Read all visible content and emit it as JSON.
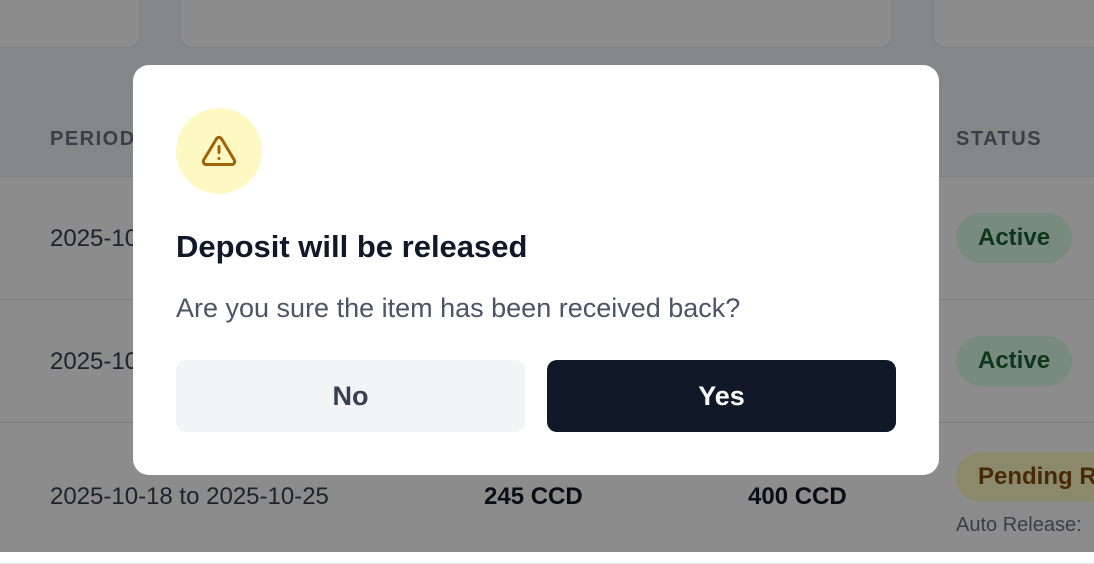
{
  "table": {
    "headers": {
      "period": "PERIOD",
      "status": "STATUS"
    },
    "rows": [
      {
        "period": "2025-10-",
        "status": "Active"
      },
      {
        "period": "2025-10-",
        "status": "Active"
      },
      {
        "period": "2025-10-18 to 2025-10-25",
        "price": "245 CCD",
        "deposit": "400 CCD",
        "status": "Pending R",
        "note": "Auto Release:"
      }
    ]
  },
  "modal": {
    "title": "Deposit will be released",
    "message": "Are you sure the item has been received back?",
    "no_label": "No",
    "yes_label": "Yes",
    "icon": "warning-triangle-icon"
  },
  "colors": {
    "overlay": "rgba(0,0,0,0.45)",
    "primary_button": "#111827",
    "warning_bg": "#fef9c3",
    "warning_icon": "#a16207"
  }
}
